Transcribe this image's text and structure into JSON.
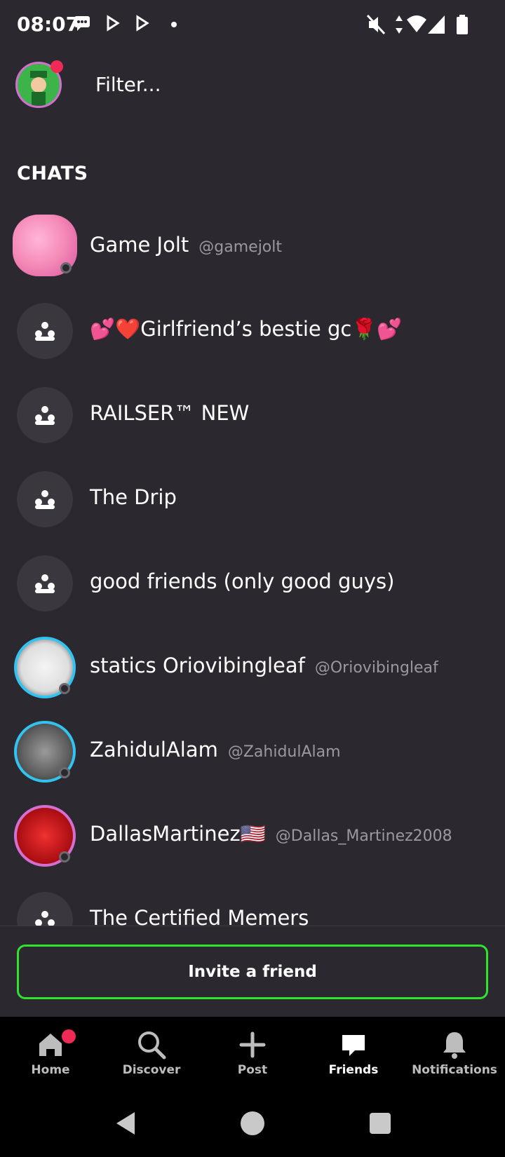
{
  "status": {
    "time": "08:07",
    "icons": [
      "message-icon",
      "play-store-icon",
      "play-store-icon",
      "dot-icon",
      "mute-icon",
      "data-icon",
      "wifi-icon",
      "signal-icon",
      "battery-icon"
    ]
  },
  "header": {
    "filter_placeholder": "Filter..."
  },
  "chats": {
    "section_title": "CHATS",
    "items": [
      {
        "name": "Game Jolt",
        "handle": "@gamejolt",
        "type": "user"
      },
      {
        "name": "💕❤️Girlfriend’s bestie gc🌹💕",
        "handle": "",
        "type": "group"
      },
      {
        "name": "RAILSER™ NEW",
        "handle": "",
        "type": "group"
      },
      {
        "name": "The Drip",
        "handle": "",
        "type": "group"
      },
      {
        "name": "good friends (only good guys)",
        "handle": "",
        "type": "group"
      },
      {
        "name": "statics Oriovibingleaf",
        "handle": "@Oriovibingleaf",
        "type": "user"
      },
      {
        "name": "ZahidulAlam",
        "handle": "@ZahidulAlam",
        "type": "user"
      },
      {
        "name": "DallasMartinez🇺🇸",
        "handle": "@Dallas_Martinez2008",
        "type": "user"
      },
      {
        "name": "The Certified Memers",
        "handle": "",
        "type": "group"
      }
    ]
  },
  "invite": {
    "label": "Invite a friend"
  },
  "nav": {
    "items": [
      {
        "label": "Home",
        "icon": "home-icon"
      },
      {
        "label": "Discover",
        "icon": "search-icon"
      },
      {
        "label": "Post",
        "icon": "plus-icon"
      },
      {
        "label": "Friends",
        "icon": "chat-icon"
      },
      {
        "label": "Notifications",
        "icon": "bell-icon"
      }
    ]
  },
  "colors": {
    "background": "#2b2830",
    "accent": "#2fe32f",
    "badge": "#ee2a55"
  }
}
